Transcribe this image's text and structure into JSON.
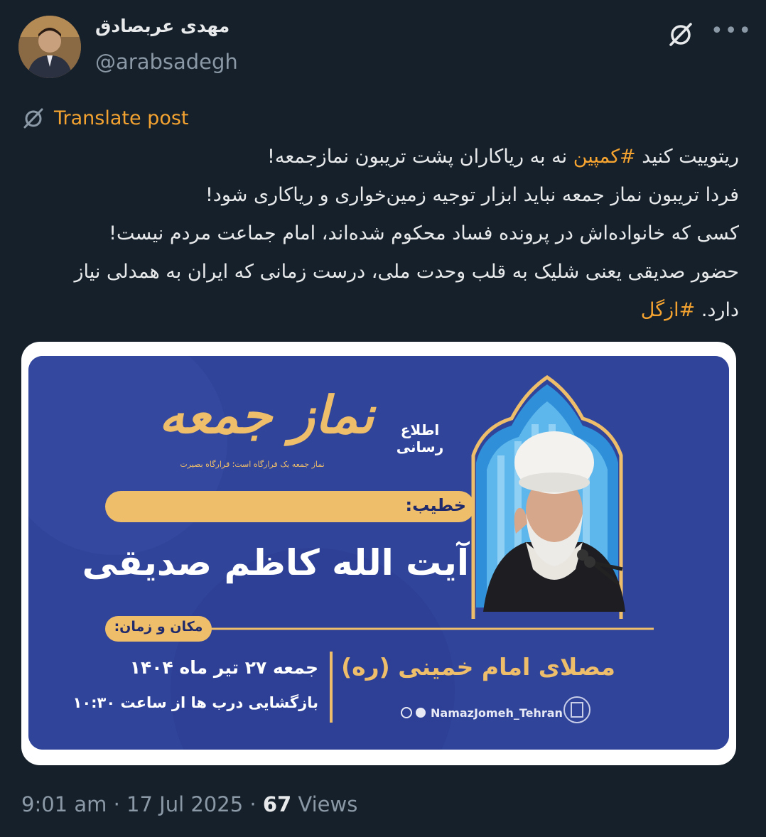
{
  "author": {
    "name": "مهدی عربصادق",
    "handle": "@arabsadegh"
  },
  "translate": {
    "label": "Translate post"
  },
  "post": {
    "line1_before": "ریتوییت کنید",
    "line1_hashtag": "#کمپین",
    "line1_after": "نه به ریاکاران پشت تریبون نمازجمعه!",
    "line2": "فردا تریبون نماز جمعه نباید ابزار توجیه زمین‌خواری و ریاکاری شود!",
    "line3": "کسی که خانواده‌اش در پرونده فساد محکوم شده‌اند، امام جماعت مردم نیست!",
    "line4": "حضور صدیقی یعنی شلیک به قلب وحدت ملی، درست زمانی که ایران به همدلی نیاز دارد.",
    "line4_hashtag": "#ازگل"
  },
  "banner": {
    "logo_title": "نماز جمعه",
    "logo_subtitle": "اطلاع رسانی",
    "logo_tagline": "نماز جمعه یک قرارگاه است؛ قرارگاه بصیرت",
    "khatib_label": "خطیب:",
    "speaker_name": "آیت الله کاظم صدیقی",
    "place_time_label": "مکان و زمان:",
    "date_line": "جمعه ۲۷ تیر ماه ۱۴۰۴",
    "doors_line": "بازگشایی درب ها از ساعت ۱۰:۳۰",
    "venue": "مصلای امام خمینی (ره)",
    "social_handle": "NamazJomeh_Tehran"
  },
  "meta": {
    "time": "9:01 am",
    "date": "17 Jul 2025",
    "views_count": "67",
    "views_label": "Views",
    "separator": "·"
  },
  "colors": {
    "background": "#15202b",
    "accent": "#f4a330",
    "banner_blue": "#30449a",
    "banner_gold": "#efbe6a"
  }
}
